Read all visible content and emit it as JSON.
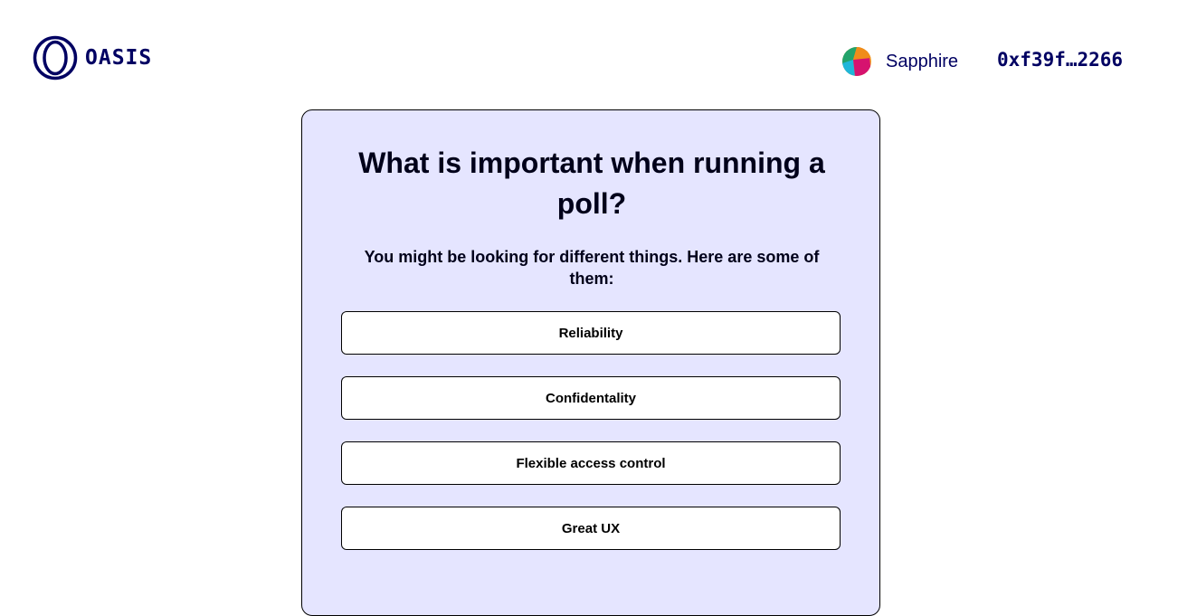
{
  "header": {
    "logo_text": "OASIS",
    "network_label": "Sapphire",
    "account_address": "0xf39f…2266"
  },
  "poll": {
    "title": "What is important when running a poll?",
    "description": "You might be looking for different things. Here are some of them:",
    "choices": [
      "Reliability",
      "Confidentality",
      "Flexible access control",
      "Great UX"
    ]
  },
  "colors": {
    "brand_navy": "#000062",
    "card_background": "#e5e5ff",
    "choice_background": "#ffffff"
  }
}
